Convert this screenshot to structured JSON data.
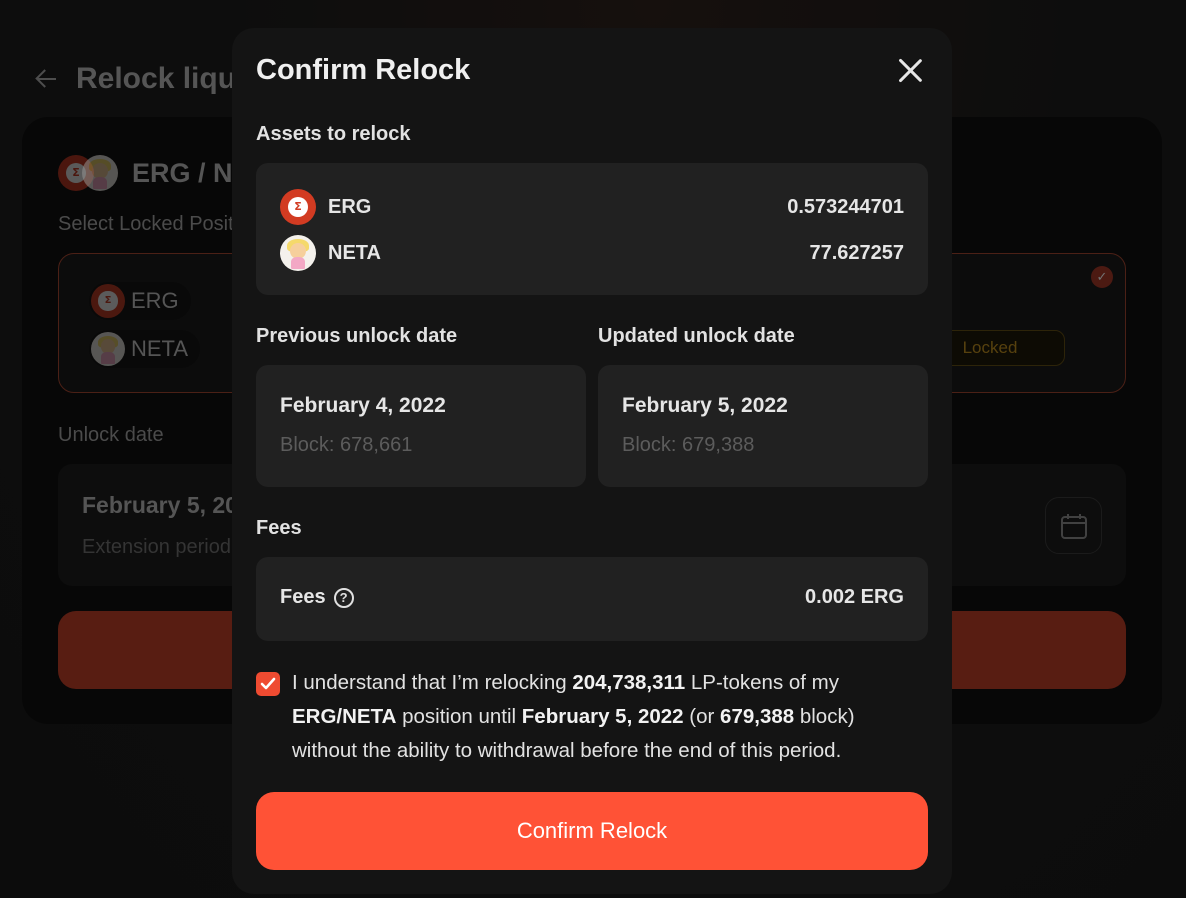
{
  "background": {
    "page_title": "Relock liquidity",
    "pair_name": "ERG / NETA",
    "select_label": "Select Locked Position",
    "tokens": [
      "ERG",
      "NETA"
    ],
    "status_badge": "Locked",
    "unlock_label": "Unlock date",
    "unlock_date": "February 5, 2022",
    "extension_text": "Extension period"
  },
  "modal": {
    "title": "Confirm Relock",
    "assets_label": "Assets to relock",
    "assets": [
      {
        "name": "ERG",
        "amount": "0.573244701",
        "icon": "erg-icon"
      },
      {
        "name": "NETA",
        "amount": "77.627257",
        "icon": "neta-icon"
      }
    ],
    "previous": {
      "label": "Previous unlock date",
      "date": "February 4, 2022",
      "block": "Block: 678,661"
    },
    "updated": {
      "label": "Updated unlock date",
      "date": "February 5, 2022",
      "block": "Block: 679,388"
    },
    "fees_section_label": "Fees",
    "fees_label": "Fees",
    "fees_value": "0.002 ERG",
    "agreement": {
      "checked": true,
      "t1": "I understand that I’m relocking ",
      "lp_amount": "204,738,311",
      "t2": " LP-tokens of my ",
      "pair": "ERG/NETA",
      "t3": " position until ",
      "date": "February 5, 2022",
      "t4": " (or ",
      "block": "679,388",
      "t5": " block) without the ability to withdrawal before the end of this period."
    },
    "confirm_button": "Confirm Relock"
  },
  "colors": {
    "accent": "#ff5236",
    "modal_bg": "#141414",
    "panel_bg": "#212121"
  }
}
